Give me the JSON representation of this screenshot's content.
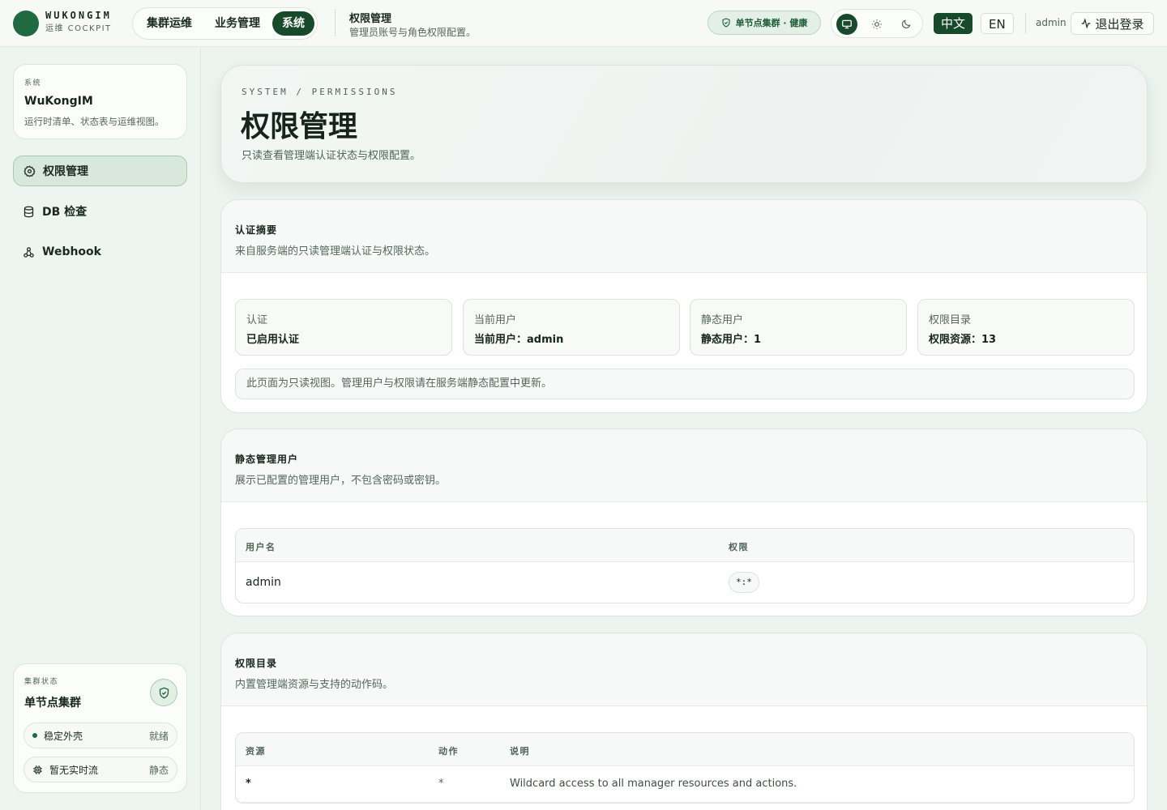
{
  "header": {
    "brand_name": "WUKONGIM",
    "brand_sub": "运维 COCKPIT",
    "nav": [
      "集群运维",
      "业务管理",
      "系统"
    ],
    "page_title": "权限管理",
    "page_sub": "管理员账号与角色权限配置。",
    "cluster_badge": "单节点集群 · 健康",
    "lang_active": "中文",
    "lang_other": "EN",
    "user": "admin",
    "logout": "退出登录"
  },
  "sidebar": {
    "sys_label": "系统",
    "sys_name": "WuKongIM",
    "sys_desc": "运行时清单、状态表与运维视图。",
    "items": [
      {
        "label": "权限管理",
        "icon": "gear-icon"
      },
      {
        "label": "DB 检查",
        "icon": "database-icon"
      },
      {
        "label": "Webhook",
        "icon": "webhook-icon"
      }
    ],
    "status_label": "集群状态",
    "status_title": "单节点集群",
    "status_rows": [
      {
        "label": "稳定外壳",
        "value": "就绪"
      },
      {
        "label": "暂无实时流",
        "value": "静态"
      }
    ]
  },
  "hero": {
    "eyebrow": "SYSTEM / PERMISSIONS",
    "title": "权限管理",
    "desc": "只读查看管理端认证状态与权限配置。"
  },
  "auth": {
    "title": "认证摘要",
    "desc": "来自服务端的只读管理端认证与权限状态。",
    "stats": [
      {
        "k": "认证",
        "v": "已启用认证"
      },
      {
        "k": "当前用户",
        "v": "当前用户：admin"
      },
      {
        "k": "静态用户",
        "v": "静态用户：1"
      },
      {
        "k": "权限目录",
        "v": "权限资源：13"
      }
    ],
    "note": "此页面为只读视图。管理用户与权限请在服务端静态配置中更新。"
  },
  "users": {
    "title": "静态管理用户",
    "desc": "展示已配置的管理用户，不包含密码或密钥。",
    "col_user": "用户名",
    "col_perm": "权限",
    "rows": [
      {
        "user": "admin",
        "perm": "*:*"
      }
    ]
  },
  "catalog": {
    "title": "权限目录",
    "desc": "内置管理端资源与支持的动作码。",
    "col_res": "资源",
    "col_act": "动作",
    "col_desc": "说明",
    "rows": [
      {
        "res": "*",
        "act": "*",
        "desc": "Wildcard access to all manager resources and actions."
      }
    ]
  }
}
